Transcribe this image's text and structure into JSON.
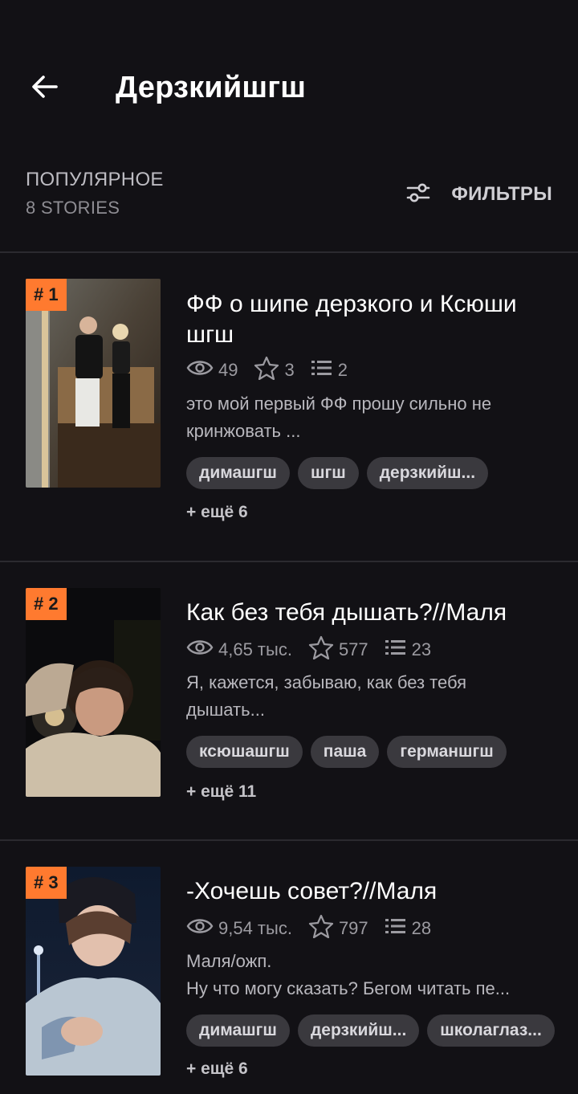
{
  "header": {
    "back_icon": "arrow-left-icon",
    "title": "Дерзкийшгш"
  },
  "section": {
    "title": "ПОПУЛЯРНОЕ",
    "count": "8 STORIES",
    "filters_label": "ФИЛЬТРЫ",
    "filters_icon": "sliders-icon"
  },
  "colors": {
    "background": "#121115",
    "rank_badge": "#ff7a2f",
    "tag_background": "#3a393e"
  },
  "stories": [
    {
      "rank": "# 1",
      "title_lines": [
        "ФФ о шипе дерзкого и Ксюши",
        "шгш"
      ],
      "views": "49",
      "votes": "3",
      "parts": "2",
      "desc_lines": [
        "это мой первый ФФ прошу сильно не",
        "кринжовать ..."
      ],
      "tags": [
        "димашгш",
        "шгш",
        "дерзкийш..."
      ],
      "more": "+ ещё 6"
    },
    {
      "rank": "# 2",
      "title_lines": [
        "Как без тебя дышать?//Маля"
      ],
      "views": "4,65 тыс.",
      "votes": "577",
      "parts": "23",
      "desc_lines": [
        "Я, кажется, забываю, как без тебя",
        "дышать..."
      ],
      "tags": [
        "ксюшашгш",
        "паша",
        "германшгш"
      ],
      "more": "+ ещё 11"
    },
    {
      "rank": "# 3",
      "title_lines": [
        "-Хочешь совет?//Маля"
      ],
      "views": "9,54 тыс.",
      "votes": "797",
      "parts": "28",
      "desc_lines": [
        "Маля/ожп.",
        "Ну что могу сказать? Бегом читать пе..."
      ],
      "tags": [
        "димашгш",
        "дерзкийш...",
        "школаглаз..."
      ],
      "more": "+ ещё 6"
    }
  ]
}
